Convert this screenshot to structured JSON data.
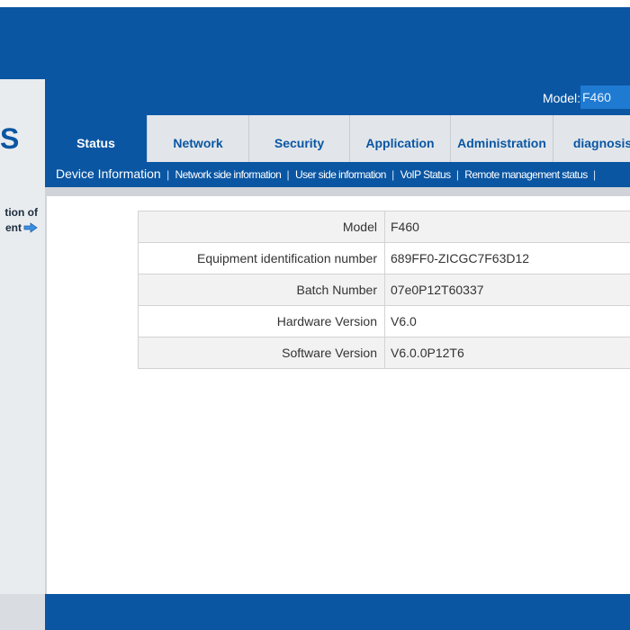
{
  "header": {
    "logo_partial": "S",
    "model_label": "Model:",
    "model_value": "F460"
  },
  "sidebar": {
    "link_line1": "tion of",
    "link_line2": "ent"
  },
  "tabs": [
    {
      "label": "Status",
      "active": true
    },
    {
      "label": "Network",
      "active": false
    },
    {
      "label": "Security",
      "active": false
    },
    {
      "label": "Application",
      "active": false
    },
    {
      "label": "Administration",
      "active": false
    },
    {
      "label": "diagnosis",
      "active": false
    }
  ],
  "submenu": {
    "active": "Device Information",
    "items": [
      "Network side information",
      "User side information",
      "VoIP Status",
      "Remote management status"
    ]
  },
  "device_info": {
    "rows": [
      {
        "key": "Model",
        "value": "F460"
      },
      {
        "key": "Equipment identification number",
        "value": "689FF0-ZICGC7F63D12"
      },
      {
        "key": "Batch Number",
        "value": "07e0P12T60337"
      },
      {
        "key": "Hardware Version",
        "value": "V6.0"
      },
      {
        "key": "Software Version",
        "value": "V6.0.0P12T6"
      }
    ]
  },
  "colors": {
    "brand_blue": "#0a56a3",
    "accent_blue": "#1f7ad1"
  }
}
